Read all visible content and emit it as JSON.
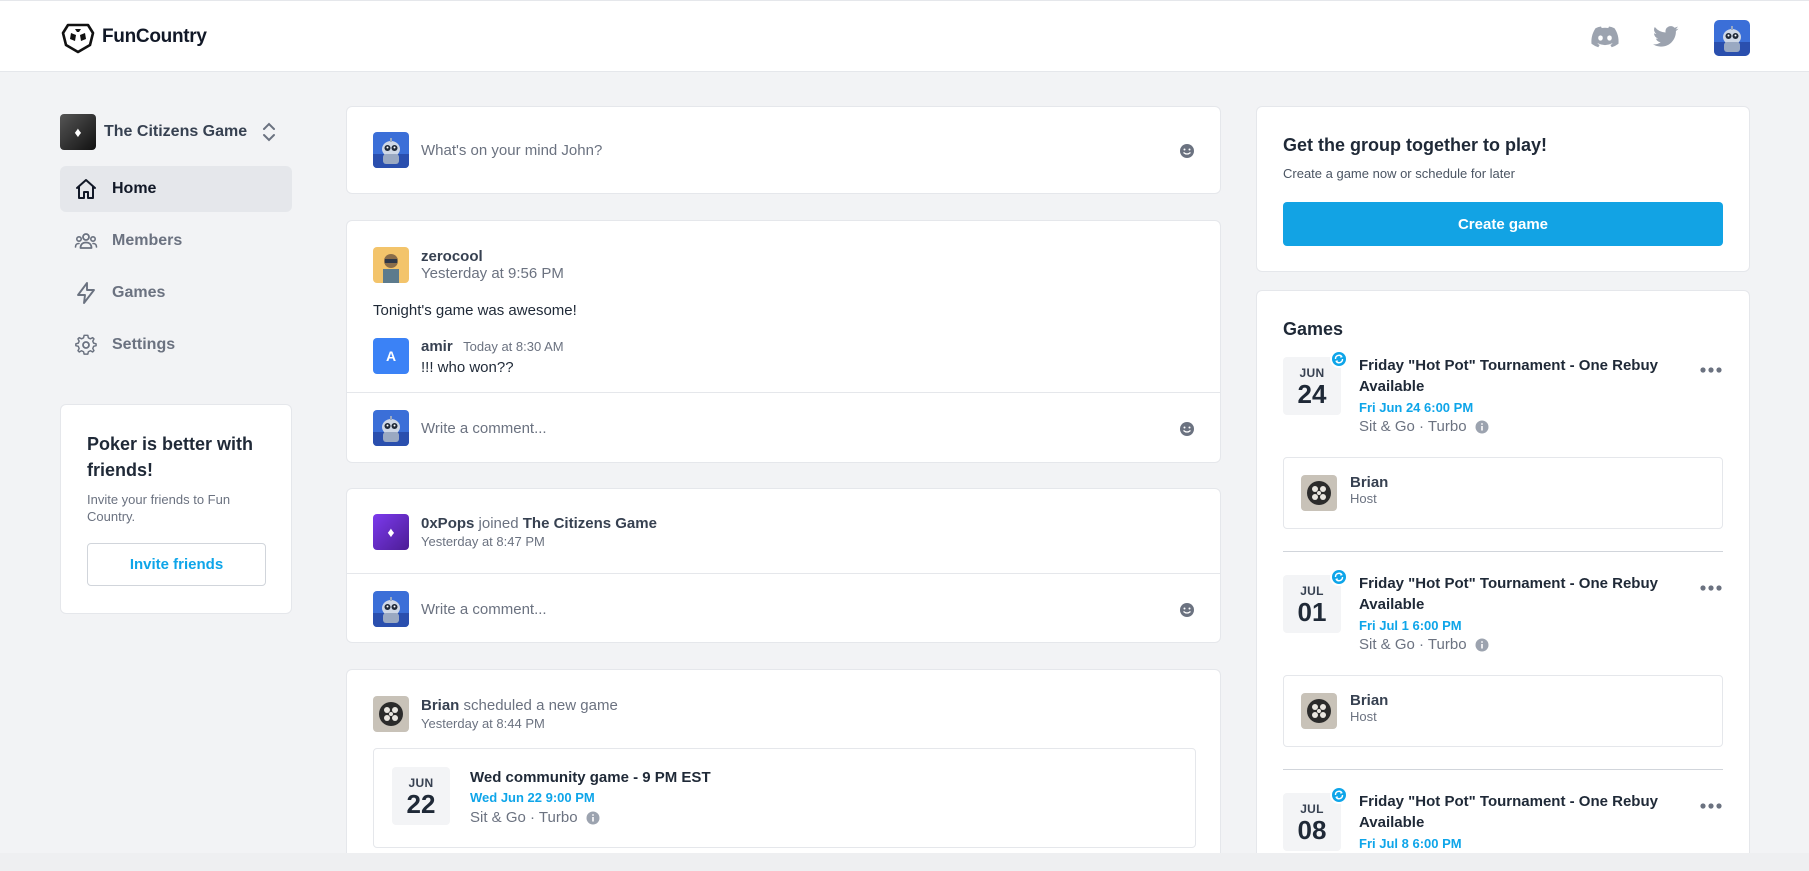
{
  "brand": {
    "name": "FunCountry"
  },
  "header": {
    "icons": [
      "discord-icon",
      "twitter-icon"
    ],
    "avatar": "user-avatar"
  },
  "sidebar": {
    "group_name": "The Citizens Game",
    "nav": [
      {
        "label": "Home",
        "icon": "home-icon",
        "active": true
      },
      {
        "label": "Members",
        "icon": "members-icon"
      },
      {
        "label": "Games",
        "icon": "bolt-icon"
      },
      {
        "label": "Settings",
        "icon": "gear-icon"
      }
    ],
    "invite": {
      "title": "Poker is better with friends!",
      "subtitle": "Invite your friends to Fun Country.",
      "button": "Invite friends"
    }
  },
  "composer": {
    "placeholder": "What's on your mind John?"
  },
  "feed": {
    "post1": {
      "author": "zerocool",
      "time": "Yesterday at 9:56 PM",
      "text": "Tonight's game was awesome!",
      "reply": {
        "avatar_letter": "A",
        "author": "amir",
        "time": "Today at 8:30 AM",
        "text": "!!! who won??"
      },
      "comment_placeholder": "Write a comment..."
    },
    "post2": {
      "author": "0xPops",
      "action": "joined",
      "target": "The Citizens Game",
      "time": "Yesterday at 8:47 PM",
      "comment_placeholder": "Write a comment..."
    },
    "post3": {
      "author": "Brian",
      "action": "scheduled a new game",
      "time": "Yesterday at 8:44 PM",
      "game": {
        "month": "JUN",
        "day": "22",
        "title": "Wed community game - 9 PM EST",
        "when": "Wed Jun 22 9:00 PM",
        "meta": "Sit & Go · Turbo"
      }
    }
  },
  "cta": {
    "title": "Get the group together to play!",
    "subtitle": "Create a game now or schedule for later",
    "button": "Create game"
  },
  "games": {
    "heading": "Games",
    "items": [
      {
        "month": "JUN",
        "day": "24",
        "title_line1": "Friday \"Hot Pot\" Tournament - One Rebuy",
        "title_line2": "Available",
        "when": "Fri Jun 24 6:00 PM",
        "meta": "Sit & Go · Turbo",
        "host": "Brian",
        "host_role": "Host"
      },
      {
        "month": "JUL",
        "day": "01",
        "title_line1": "Friday \"Hot Pot\" Tournament - One Rebuy",
        "title_line2": "Available",
        "when": "Fri Jul 1 6:00 PM",
        "meta": "Sit & Go · Turbo",
        "host": "Brian",
        "host_role": "Host"
      },
      {
        "month": "JUL",
        "day": "08",
        "title_line1": "Friday \"Hot Pot\" Tournament - One Rebuy",
        "title_line2": "Available",
        "when": "Fri Jul 8 6:00 PM"
      }
    ]
  },
  "colors": {
    "accent": "#12a3e4",
    "link": "#0ea5e9",
    "background": "#f2f3f5"
  }
}
